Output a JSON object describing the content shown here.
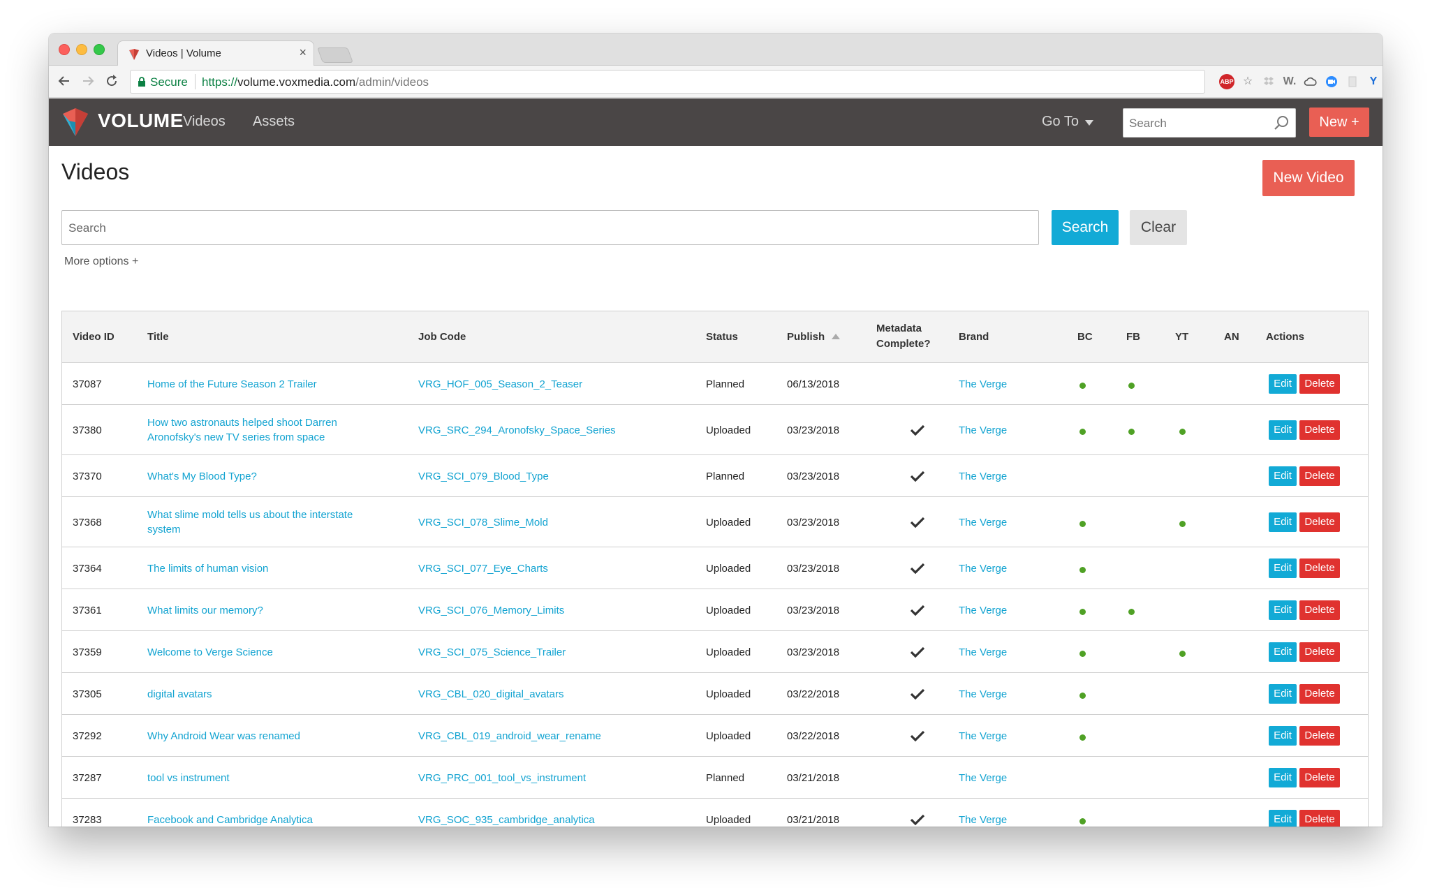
{
  "browser": {
    "tab_title": "Videos | Volume",
    "tab_close": "×",
    "secure_label": "Secure",
    "url_scheme": "https://",
    "url_host": "volume.voxmedia.com",
    "url_path": "/admin/videos",
    "extensions": [
      "ABP",
      "☆",
      "dropbox-icon",
      "W.",
      "cloud-icon",
      "zoom-icon",
      "pocket-icon",
      "Y",
      "⋮"
    ]
  },
  "appbar": {
    "logo": "VOLUME",
    "nav": [
      "Videos",
      "Assets"
    ],
    "goto": "Go To",
    "search_placeholder": "Search",
    "new_label": "New  +"
  },
  "page": {
    "title": "Videos",
    "new_video": "New Video",
    "search_placeholder": "Search",
    "search_button": "Search",
    "clear_button": "Clear",
    "more_options": "More options +"
  },
  "table": {
    "headers": {
      "video_id": "Video ID",
      "title": "Title",
      "job_code": "Job Code",
      "status": "Status",
      "publish": "Publish",
      "metadata_line1": "Metadata",
      "metadata_line2": "Complete?",
      "brand": "Brand",
      "bc": "BC",
      "fb": "FB",
      "yt": "YT",
      "an": "AN",
      "actions": "Actions"
    },
    "edit_label": "Edit",
    "delete_label": "Delete",
    "rows": [
      {
        "id": "37087",
        "title": "Home of the Future Season 2 Trailer",
        "job": "VRG_HOF_005_Season_2_Teaser",
        "status": "Planned",
        "publish": "06/13/2018",
        "meta": false,
        "brand": "The Verge",
        "bc": true,
        "fb": true,
        "yt": false,
        "an": false
      },
      {
        "id": "37380",
        "title": "How two astronauts helped shoot Darren Aronofsky's new TV series from space",
        "job": "VRG_SRC_294_Aronofsky_Space_Series",
        "status": "Uploaded",
        "publish": "03/23/2018",
        "meta": true,
        "brand": "The Verge",
        "bc": true,
        "fb": true,
        "yt": true,
        "an": false
      },
      {
        "id": "37370",
        "title": "What's My Blood Type?",
        "job": "VRG_SCI_079_Blood_Type",
        "status": "Planned",
        "publish": "03/23/2018",
        "meta": true,
        "brand": "The Verge",
        "bc": false,
        "fb": false,
        "yt": false,
        "an": false
      },
      {
        "id": "37368",
        "title": "What slime mold tells us about the interstate system",
        "job": "VRG_SCI_078_Slime_Mold",
        "status": "Uploaded",
        "publish": "03/23/2018",
        "meta": true,
        "brand": "The Verge",
        "bc": true,
        "fb": false,
        "yt": true,
        "an": false
      },
      {
        "id": "37364",
        "title": "The limits of human vision",
        "job": "VRG_SCI_077_Eye_Charts",
        "status": "Uploaded",
        "publish": "03/23/2018",
        "meta": true,
        "brand": "The Verge",
        "bc": true,
        "fb": false,
        "yt": false,
        "an": false
      },
      {
        "id": "37361",
        "title": "What limits our memory?",
        "job": "VRG_SCI_076_Memory_Limits",
        "status": "Uploaded",
        "publish": "03/23/2018",
        "meta": true,
        "brand": "The Verge",
        "bc": true,
        "fb": true,
        "yt": false,
        "an": false
      },
      {
        "id": "37359",
        "title": "Welcome to Verge Science",
        "job": "VRG_SCI_075_Science_Trailer",
        "status": "Uploaded",
        "publish": "03/23/2018",
        "meta": true,
        "brand": "The Verge",
        "bc": true,
        "fb": false,
        "yt": true,
        "an": false
      },
      {
        "id": "37305",
        "title": "digital avatars",
        "job": "VRG_CBL_020_digital_avatars",
        "status": "Uploaded",
        "publish": "03/22/2018",
        "meta": true,
        "brand": "The Verge",
        "bc": true,
        "fb": false,
        "yt": false,
        "an": false
      },
      {
        "id": "37292",
        "title": "Why Android Wear was renamed",
        "job": "VRG_CBL_019_android_wear_rename",
        "status": "Uploaded",
        "publish": "03/22/2018",
        "meta": true,
        "brand": "The Verge",
        "bc": true,
        "fb": false,
        "yt": false,
        "an": false
      },
      {
        "id": "37287",
        "title": "tool vs instrument",
        "job": "VRG_PRC_001_tool_vs_instrument",
        "status": "Planned",
        "publish": "03/21/2018",
        "meta": false,
        "brand": "The Verge",
        "bc": false,
        "fb": false,
        "yt": false,
        "an": false
      },
      {
        "id": "37283",
        "title": "Facebook and Cambridge Analytica",
        "job": "VRG_SOC_935_cambridge_analytica",
        "status": "Uploaded",
        "publish": "03/21/2018",
        "meta": true,
        "brand": "The Verge",
        "bc": true,
        "fb": false,
        "yt": false,
        "an": false
      }
    ]
  },
  "colors": {
    "accent_red": "#e95f54",
    "accent_blue": "#12aad6",
    "link": "#12a3d1",
    "dot_green": "#4fa125",
    "navbar": "#4a4646"
  }
}
